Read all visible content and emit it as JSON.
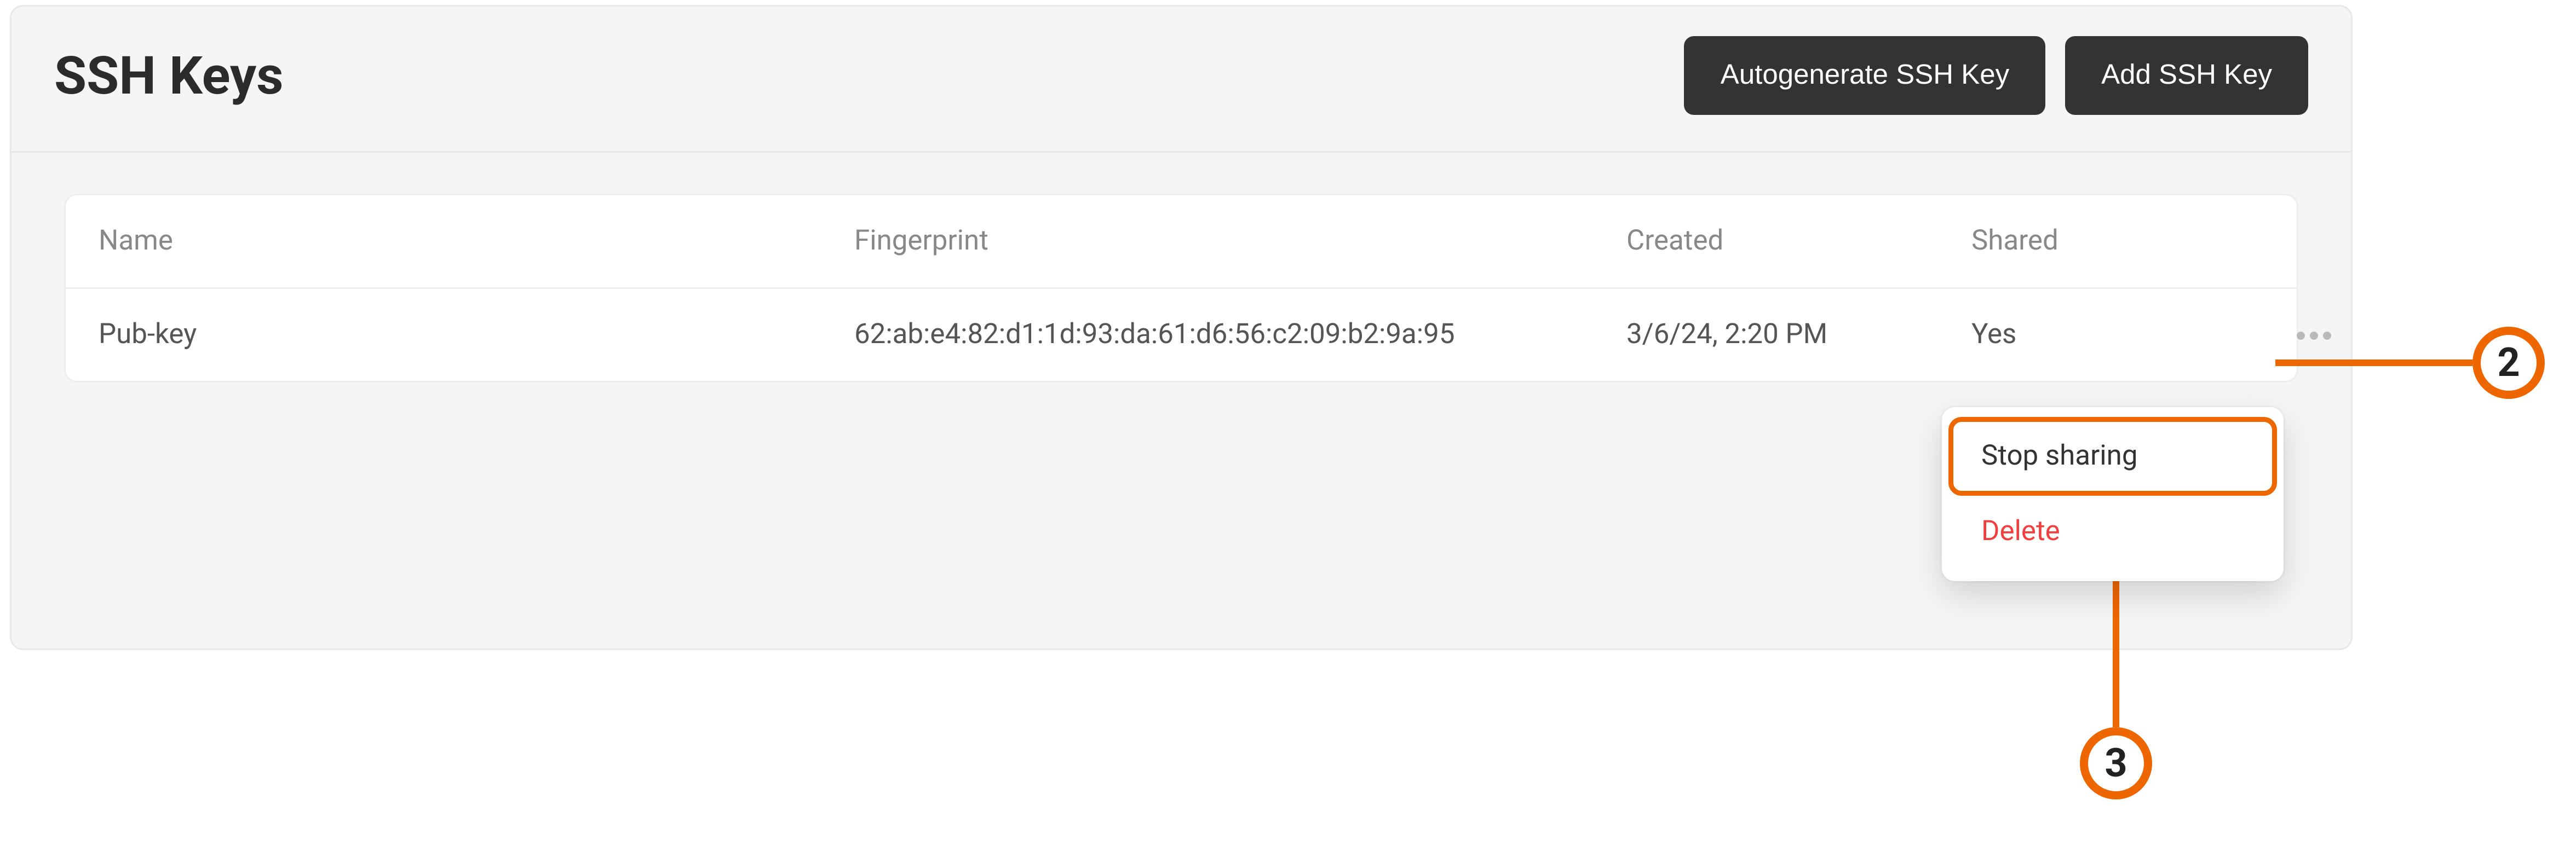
{
  "header": {
    "title": "SSH Keys",
    "autogenerate_label": "Autogenerate SSH Key",
    "add_label": "Add SSH Key"
  },
  "table": {
    "columns": {
      "name": "Name",
      "fingerprint": "Fingerprint",
      "created": "Created",
      "shared": "Shared"
    },
    "rows": [
      {
        "name": "Pub-key",
        "fingerprint": "62:ab:e4:82:d1:1d:93:da:61:d6:56:c2:09:b2:9a:95",
        "created": "3/6/24, 2:20 PM",
        "shared": "Yes"
      }
    ]
  },
  "dropdown": {
    "stop_sharing": "Stop sharing",
    "delete": "Delete"
  },
  "callouts": {
    "two": "2",
    "three": "3"
  },
  "colors": {
    "accent": "#ee6600",
    "button_bg": "#333333",
    "danger": "#f13e3e",
    "panel_bg": "#f5f5f5"
  }
}
